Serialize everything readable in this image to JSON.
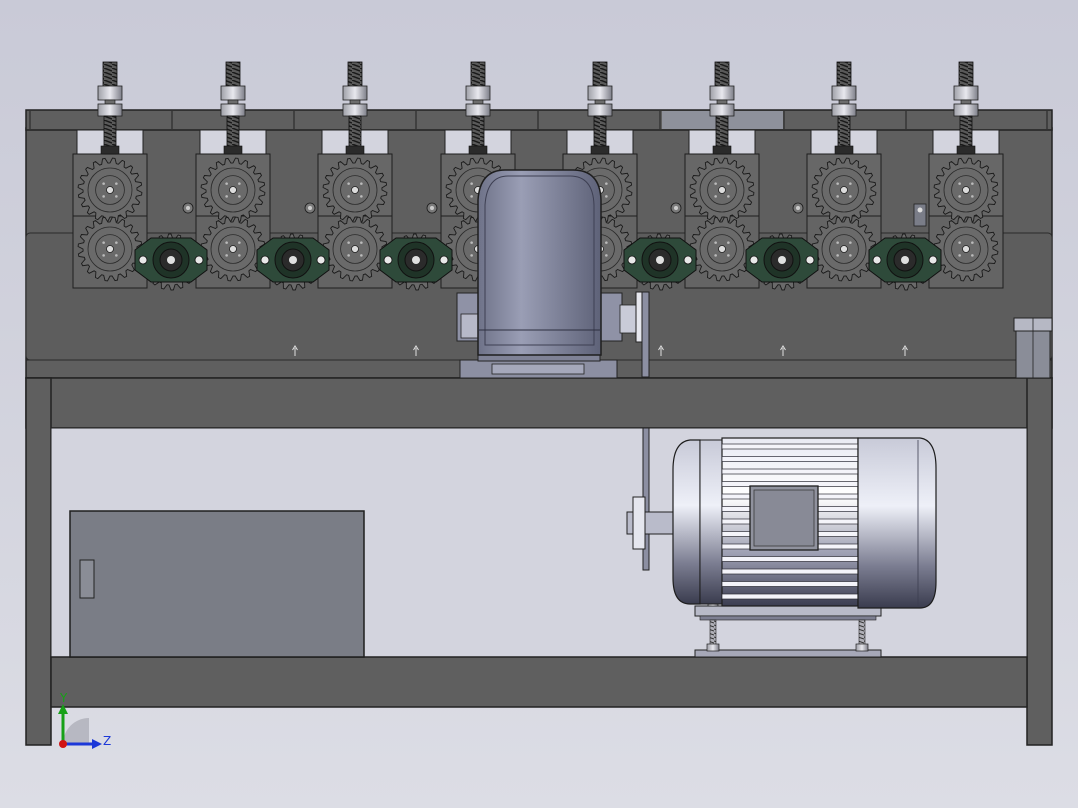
{
  "viewport": {
    "background_color": "#d0d1dc",
    "model_description": "",
    "triad": {
      "x_label": "",
      "y_label": "Y",
      "z_label": "Z"
    }
  },
  "colors": {
    "frame": "#5f5f5f",
    "frame_edge": "#222222",
    "gear_housing": "#6a6a6a",
    "bearing_green": "#2e4a3a",
    "metal_light": "#c6c8d4",
    "gearbox_body": "#8b8fa6",
    "electrical_box": "#7a7d86",
    "axis_x": "#d11414",
    "axis_y": "#17a017",
    "axis_z": "#1c38d8"
  },
  "components": {
    "adjusting_screws": 8,
    "gear_stations_upper": 8,
    "bearing_blocks": 6,
    "gearbox": 1,
    "electric_motor": 1,
    "electrical_box": 1
  }
}
